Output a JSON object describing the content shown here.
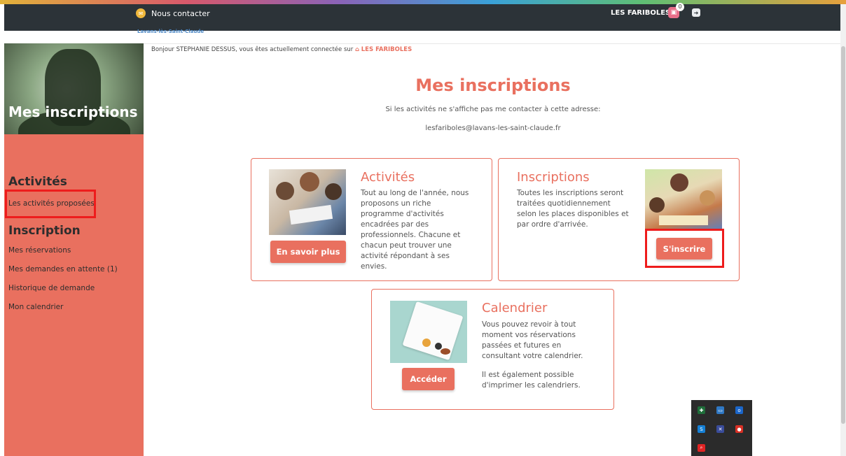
{
  "topbar": {
    "contact_label": "Nous contacter",
    "brand_label": "LES FARIBOLES",
    "cart_count": "0",
    "underbar_text": "Lavans-lès-Saint-Claude"
  },
  "sidebar": {
    "title": "Mes inscriptions",
    "section_activities": "Activités",
    "activities_link": "Les activités proposées",
    "section_inscription": "Inscription",
    "links": [
      "Mes réservations",
      "Mes demandes en attente (1)",
      "Historique de demande",
      "Mon calendrier"
    ]
  },
  "greeting": {
    "prefix": "Bonjour STEPHANIE DESSUS, vous êtes actuellement connectée sur",
    "brand": "LES FARIBOLES"
  },
  "main": {
    "title": "Mes inscriptions",
    "notice": "Si les activités ne s'affiche pas me contacter à cette adresse:",
    "email": "lesfariboles@lavans-les-saint-claude.fr"
  },
  "cards": {
    "activites": {
      "title": "Activités",
      "text": "Tout au long de l'année, nous proposons un riche programme d'activités encadrées par des professionnels. Chacune et chacun peut trouver une activité répondant à ses envies.",
      "button": "En savoir plus"
    },
    "inscriptions": {
      "title": "Inscriptions",
      "text": "Toutes les inscriptions seront traitées quotidiennement selon les places disponibles et par ordre d'arrivée.",
      "button": "S'inscrire"
    },
    "calendrier": {
      "title": "Calendrier",
      "text1": "Vous pouvez revoir à tout moment vos réservations passées et futures en consultant votre calendrier.",
      "text2": "Il est également possible d'imprimer les calendriers.",
      "button": "Accéder"
    }
  },
  "colors": {
    "accent": "#e9705f",
    "topbar": "#2c3338",
    "highlight": "#ee1c1c"
  }
}
